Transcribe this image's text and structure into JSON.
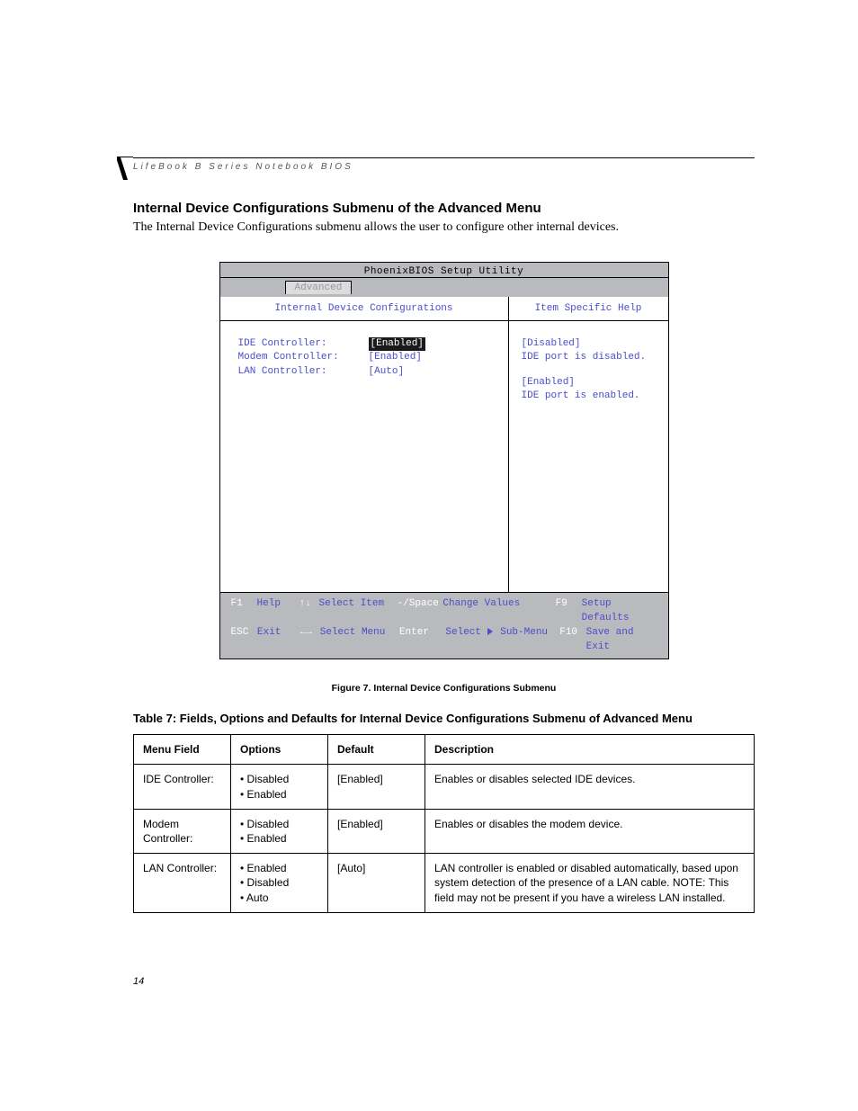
{
  "header": {
    "running_title": "LifeBook B Series Notebook BIOS"
  },
  "section": {
    "title": "Internal Device Configurations Submenu of the Advanced Menu",
    "intro": "The Internal Device Configurations submenu allows the user to configure other internal devices."
  },
  "bios": {
    "app_title": "PhoenixBIOS Setup Utility",
    "tab": "Advanced",
    "left_title": "Internal Device Configurations",
    "right_title": "Item Specific Help",
    "fields": [
      {
        "label": "IDE Controller:",
        "value": "[Enabled]",
        "selected": true
      },
      {
        "label": "Modem Controller:",
        "value": "[Enabled]",
        "selected": false
      },
      {
        "label": "LAN Controller:",
        "value": "[Auto]",
        "selected": false
      }
    ],
    "help": {
      "l1": "[Disabled]",
      "l2": "IDE port is disabled.",
      "l3": "[Enabled]",
      "l4": "IDE port is enabled."
    },
    "footer": {
      "r1": {
        "k1": "F1",
        "v1": "Help",
        "k2": "↑↓",
        "v2": "Select Item",
        "k3": "-/Space",
        "v3": "Change Values",
        "k4": "F9",
        "v4": "Setup Defaults"
      },
      "r2": {
        "k1": "ESC",
        "v1": "Exit",
        "k2": "←→",
        "v2": "Select Menu",
        "k3": "Enter",
        "v3_a": "Select ",
        "v3_b": " Sub-Menu",
        "k4": "F10",
        "v4": "Save and Exit"
      }
    }
  },
  "figure_caption": "Figure 7.  Internal Device Configurations Submenu",
  "table": {
    "title": "Table 7: Fields, Options and Defaults for Internal Device Configurations Submenu of Advanced Menu",
    "headers": {
      "c1": "Menu Field",
      "c2": "Options",
      "c3": "Default",
      "c4": "Description"
    },
    "rows": [
      {
        "field": "IDE Controller:",
        "options": [
          "Disabled",
          "Enabled"
        ],
        "default": "[Enabled]",
        "desc": "Enables or disables selected IDE devices."
      },
      {
        "field": "Modem Controller:",
        "options": [
          "Disabled",
          "Enabled"
        ],
        "default": "[Enabled]",
        "desc": "Enables or disables the modem device."
      },
      {
        "field": "LAN Controller:",
        "options": [
          "Enabled",
          "Disabled",
          "Auto"
        ],
        "default": "[Auto]",
        "desc": "LAN controller is enabled or disabled automatically, based upon system detection of the presence of a LAN cable. NOTE: This field may not be present if you have a wireless LAN installed."
      }
    ]
  },
  "page_number": "14"
}
